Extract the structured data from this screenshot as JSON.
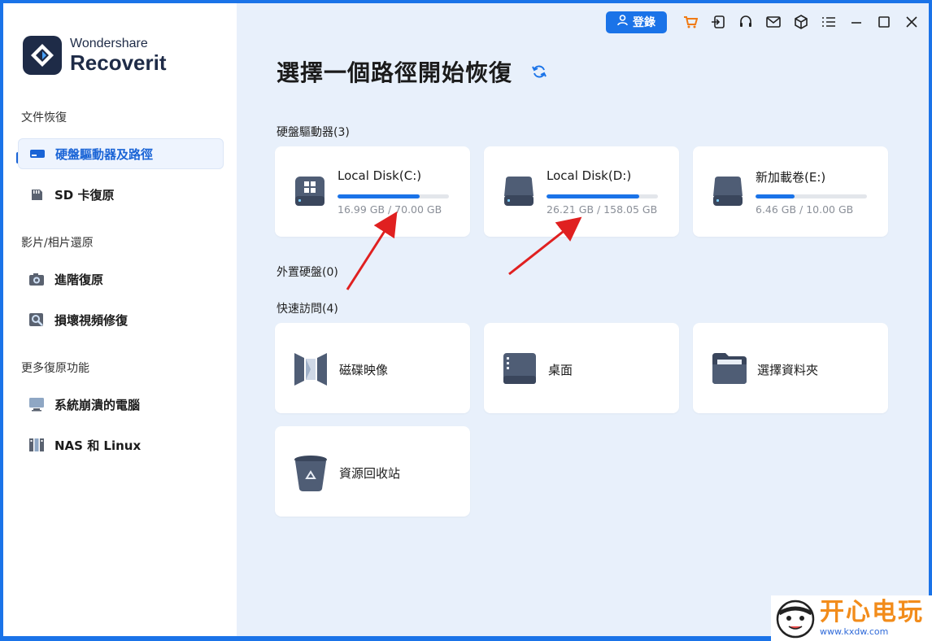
{
  "app": {
    "brand": "Wondershare",
    "product": "Recoverit"
  },
  "topbar": {
    "login_label": "登錄",
    "icons": [
      "user-icon",
      "cart-icon",
      "sign-in-icon",
      "headset-icon",
      "mail-icon",
      "box-icon",
      "menu-icon",
      "minimize-icon",
      "maximize-icon",
      "close-icon"
    ]
  },
  "sidebar": {
    "sections": [
      {
        "title": "文件恢復",
        "items": [
          {
            "label": "硬盤驅動器及路徑",
            "icon": "hard-drive-icon",
            "active": true
          },
          {
            "label": "SD 卡復原",
            "icon": "sd-card-icon",
            "active": false
          }
        ]
      },
      {
        "title": "影片/相片還原",
        "items": [
          {
            "label": "進階復原",
            "icon": "camera-icon",
            "active": false
          },
          {
            "label": "損壞視頻修復",
            "icon": "video-repair-icon",
            "active": false
          }
        ]
      },
      {
        "title": "更多復原功能",
        "items": [
          {
            "label": "系統崩潰的電腦",
            "icon": "monitor-icon",
            "active": false
          },
          {
            "label": "NAS 和 Linux",
            "icon": "nas-icon",
            "active": false
          }
        ]
      }
    ]
  },
  "main": {
    "title": "選擇一個路徑開始恢復",
    "drives_title": "硬盤驅動器(3)",
    "drives": [
      {
        "name": "Local Disk(C:)",
        "size": "16.99 GB / 70.00 GB",
        "fill": 0.74,
        "windows": true
      },
      {
        "name": "Local Disk(D:)",
        "size": "26.21 GB / 158.05 GB",
        "fill": 0.83,
        "windows": false
      },
      {
        "name": "新加載卷(E:)",
        "size": "6.46 GB / 10.00 GB",
        "fill": 0.35,
        "windows": false
      }
    ],
    "external_title": "外置硬盤(0)",
    "quick_title": "快速訪問(4)",
    "quick": [
      {
        "label": "磁碟映像",
        "icon": "disk-image-icon"
      },
      {
        "label": "桌面",
        "icon": "desktop-icon"
      },
      {
        "label": "選擇資料夾",
        "icon": "folder-icon"
      },
      {
        "label": "資源回收站",
        "icon": "recycle-bin-icon"
      }
    ]
  },
  "watermark": {
    "text": "开心电玩",
    "url": "www.kxdw.com"
  },
  "colors": {
    "accent": "#1a73e8",
    "sidebar_bg": "#ffffff",
    "main_bg": "#e8f0fb",
    "annotation_arrow": "#e02020"
  }
}
